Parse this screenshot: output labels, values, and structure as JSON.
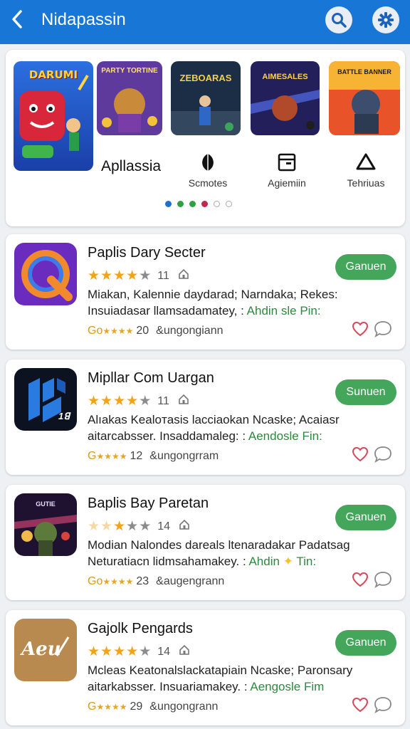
{
  "header": {
    "title": "Nidapassin",
    "back_icon": "chevron-left-icon",
    "search_icon": "search-icon",
    "settings_icon": "gear-icon",
    "bar_color": "#1877d6"
  },
  "featured": {
    "label": "Apllassia",
    "banners": [
      {
        "title": "DARUMI"
      },
      {
        "title": "PARTY TORTINE"
      },
      {
        "title": "ZEBOARAS"
      },
      {
        "title": "AIMESALES"
      },
      {
        "title": "BATTLE BANNER"
      }
    ],
    "categories": [
      {
        "label": "Scmotes",
        "icon": "leaf-icon"
      },
      {
        "label": "Agiemiin",
        "icon": "window-icon"
      },
      {
        "label": "Tehriuas",
        "icon": "triangle-icon"
      }
    ],
    "dots": [
      {
        "color": "#1f6fd1",
        "hollow": false
      },
      {
        "color": "#2ea043",
        "hollow": false
      },
      {
        "color": "#2ea043",
        "hollow": false
      },
      {
        "color": "#c0284b",
        "hollow": false
      },
      {
        "color": "#ffffff",
        "hollow": true
      },
      {
        "color": "#ffffff",
        "hollow": true
      }
    ]
  },
  "apps": [
    {
      "name": "Paplis Dary Secter",
      "stars": 4,
      "rating_count": "11",
      "desc_line1": "Miakan, Kalennie daydarad; Narndaka; Rekes:",
      "desc_line2_text": "Insuiadasar llamsadamatey, :",
      "desc_line2_link": "Ahdin sle Pin:",
      "meta_prefix": "Go",
      "meta_number": "20",
      "meta_text": "&ungongiann",
      "button": "Ganuen"
    },
    {
      "name": "Mipllar Com Uargan",
      "stars": 4,
      "rating_count": "11",
      "desc_line1": "Alıakas Kealoтasis lacciaokan Ncaske; Acaiasr",
      "desc_line2_text": "aitarcabsser. Insaddamaleg: :",
      "desc_line2_link": "Aendosle Fin:",
      "meta_prefix": "G",
      "meta_number": "12",
      "meta_text": "&ungongrram",
      "button": "Sunuen"
    },
    {
      "name": "Baplis Bay Paretan",
      "stars": 3,
      "rating_count": "14",
      "desc_line1": "Modian Nalondes dareals ltenaradakar Padatsag",
      "desc_line2_text": "Neturatiacn lidmsahamakey. :",
      "desc_line2_link": "Ahdin",
      "desc_line2_tail": "Tin:",
      "meta_prefix": "Go",
      "meta_number": "23",
      "meta_text": "&augengrann",
      "button": "Ganuen"
    },
    {
      "name": "Gajolk Pengards",
      "stars": 4,
      "rating_count": "14",
      "desc_line1": "Mcleas Keatonalslackatapiain Ncaske; Paronsary",
      "desc_line2_text": "aitarkabsser. Insuariamakey. :",
      "desc_line2_link": "Aengosle Fim",
      "meta_prefix": "G",
      "meta_number": "29",
      "meta_text": "&ungongrann",
      "button": "Ganuen",
      "icon_text": "Aeu"
    }
  ]
}
